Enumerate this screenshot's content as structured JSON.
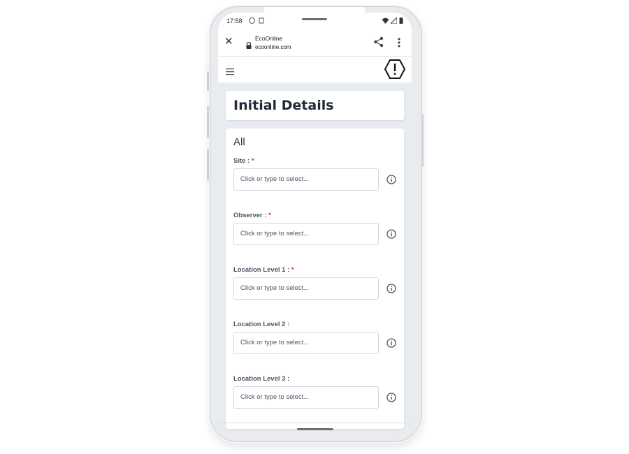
{
  "status_bar": {
    "time": "17:58",
    "app_icons": [
      "whatsapp-icon",
      "notification-icon"
    ],
    "right_icons": [
      "wifi-icon",
      "signal-icon",
      "battery-icon"
    ]
  },
  "browser": {
    "site_name": "EcoOnline",
    "url": "ecoonline.com",
    "icons": [
      "close-icon",
      "lock-icon",
      "share-icon",
      "more-vertical-icon"
    ]
  },
  "app_header": {
    "icons": [
      "hamburger-menu-icon",
      "hexagon-alert-logo-icon"
    ]
  },
  "page": {
    "title": "Initial Details",
    "section": "All",
    "fields": [
      {
        "label": "Site :",
        "required": true,
        "placeholder": "Click or type to select..."
      },
      {
        "label": "Observer :",
        "required": true,
        "placeholder": "Click or type to select..."
      },
      {
        "label": "Location Level 1 :",
        "required": true,
        "placeholder": "Click or type to select..."
      },
      {
        "label": "Location Level 2 :",
        "required": false,
        "placeholder": "Click or type to select..."
      },
      {
        "label": "Location Level 3 :",
        "required": false,
        "placeholder": "Click or type to select..."
      }
    ],
    "required_marker": "*"
  },
  "colors": {
    "accent_required": "#d32f2f",
    "screen_bg": "#e8ebef",
    "title_text": "#1f2937"
  }
}
